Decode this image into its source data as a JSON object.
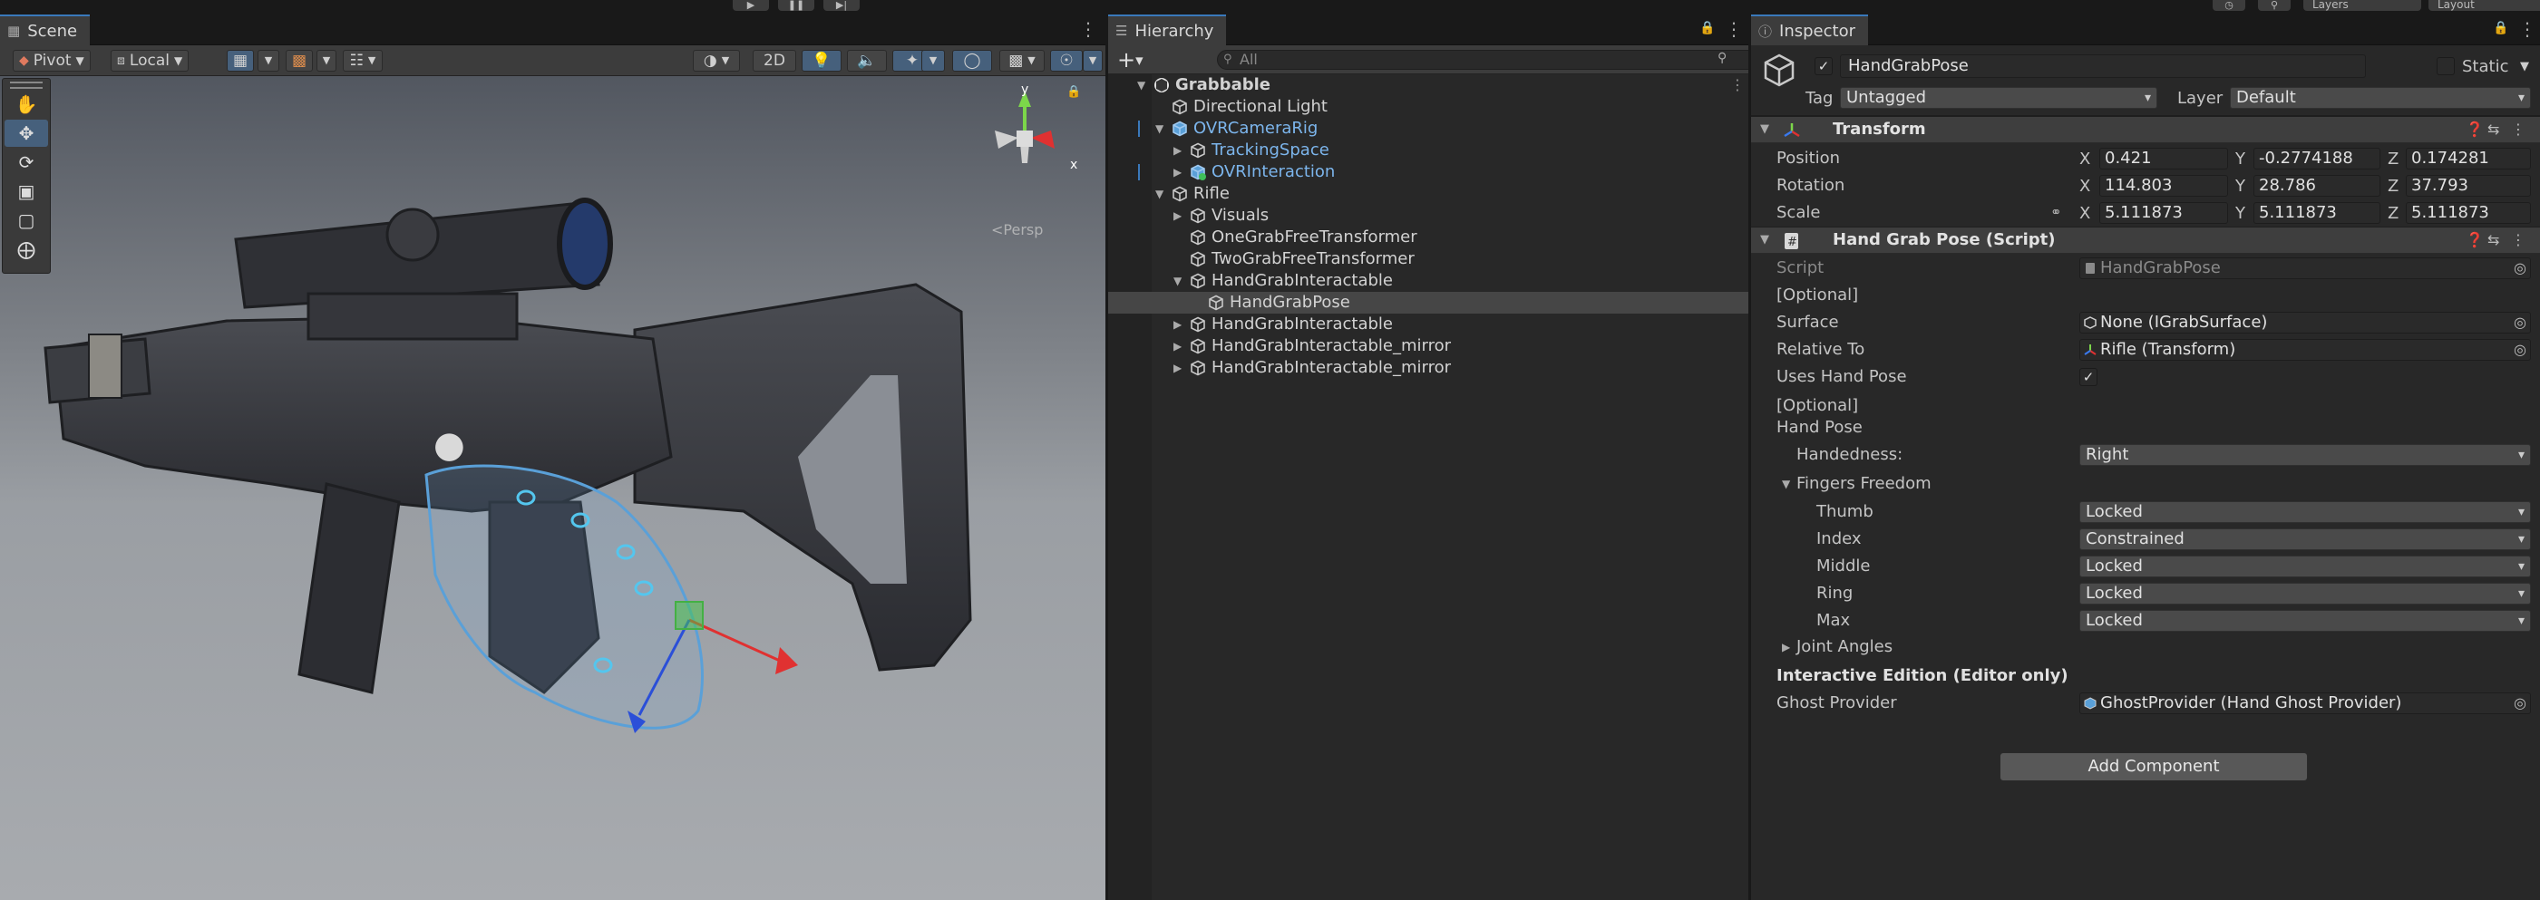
{
  "toolbar": {
    "play_icon": "play-icon",
    "pause_icon": "pause-icon",
    "step_icon": "step-icon",
    "layers": "Layers",
    "layout": "Layout"
  },
  "scene": {
    "tab": "Scene",
    "pivot": "Pivot",
    "local": "Local",
    "mode_2d": "2D",
    "persp": "<Persp",
    "gizmo_y": "y",
    "gizmo_x": "x"
  },
  "hierarchy": {
    "tab": "Hierarchy",
    "search_placeholder": "All",
    "items": [
      {
        "label": "Grabbable",
        "depth": 0,
        "expanded": true,
        "bold": true,
        "icon": "scene"
      },
      {
        "label": "Directional Light",
        "depth": 1,
        "expanded": null,
        "icon": "cube"
      },
      {
        "label": "OVRCameraRig",
        "depth": 1,
        "expanded": true,
        "blue": true,
        "icon": "prefab",
        "more": true
      },
      {
        "label": "TrackingSpace",
        "depth": 2,
        "expanded": false,
        "blue": true,
        "icon": "cube"
      },
      {
        "label": "OVRInteraction",
        "depth": 2,
        "expanded": false,
        "blue": true,
        "icon": "prefab-added",
        "more": true
      },
      {
        "label": "Rifle",
        "depth": 1,
        "expanded": true,
        "icon": "cube"
      },
      {
        "label": "Visuals",
        "depth": 2,
        "expanded": false,
        "icon": "cube"
      },
      {
        "label": "OneGrabFreeTransformer",
        "depth": 2,
        "expanded": null,
        "icon": "cube"
      },
      {
        "label": "TwoGrabFreeTransformer",
        "depth": 2,
        "expanded": null,
        "icon": "cube"
      },
      {
        "label": "HandGrabInteractable",
        "depth": 2,
        "expanded": true,
        "icon": "cube"
      },
      {
        "label": "HandGrabPose",
        "depth": 3,
        "expanded": null,
        "icon": "cube",
        "selected": true
      },
      {
        "label": "HandGrabInteractable",
        "depth": 2,
        "expanded": false,
        "icon": "cube"
      },
      {
        "label": "HandGrabInteractable_mirror",
        "depth": 2,
        "expanded": false,
        "icon": "cube"
      },
      {
        "label": "HandGrabInteractable_mirror",
        "depth": 2,
        "expanded": false,
        "icon": "cube"
      }
    ]
  },
  "inspector": {
    "tab": "Inspector",
    "object_name": "HandGrabPose",
    "static_label": "Static",
    "tag_label": "Tag",
    "tag_value": "Untagged",
    "layer_label": "Layer",
    "layer_value": "Default",
    "transform": {
      "title": "Transform",
      "position_label": "Position",
      "rotation_label": "Rotation",
      "scale_label": "Scale",
      "axis_x": "X",
      "axis_y": "Y",
      "axis_z": "Z",
      "position": {
        "x": "0.421",
        "y": "-0.2774188",
        "z": "0.174281"
      },
      "rotation": {
        "x": "114.803",
        "y": "28.786",
        "z": "37.793"
      },
      "scale": {
        "x": "5.111873",
        "y": "5.111873",
        "z": "5.111873"
      }
    },
    "hand_grab_pose": {
      "title": "Hand Grab Pose (Script)",
      "script_label": "Script",
      "script_value": "HandGrabPose",
      "optional1": "[Optional]",
      "surface_label": "Surface",
      "surface_value": "None (IGrabSurface)",
      "relative_to_label": "Relative To",
      "relative_to_value": "Rifle (Transform)",
      "uses_hand_pose_label": "Uses Hand Pose",
      "optional2": "[Optional]",
      "hand_pose_label": "Hand Pose",
      "handedness_label": "Handedness:",
      "handedness_value": "Right",
      "fingers_freedom_label": "Fingers Freedom",
      "fingers": [
        {
          "name": "Thumb",
          "value": "Locked"
        },
        {
          "name": "Index",
          "value": "Constrained"
        },
        {
          "name": "Middle",
          "value": "Locked"
        },
        {
          "name": "Ring",
          "value": "Locked"
        },
        {
          "name": "Max",
          "value": "Locked"
        }
      ],
      "joint_angles_label": "Joint Angles",
      "interactive_edition_label": "Interactive Edition (Editor only)",
      "ghost_provider_label": "Ghost Provider",
      "ghost_provider_value": "GhostProvider (Hand Ghost Provider)"
    },
    "add_component": "Add Component"
  }
}
